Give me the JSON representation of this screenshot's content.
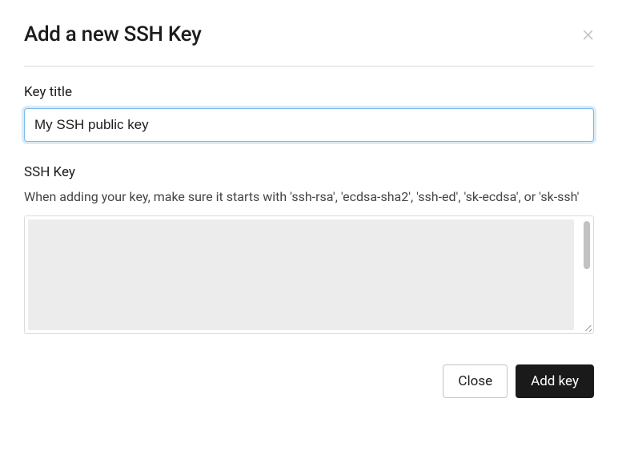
{
  "dialog": {
    "title": "Add a new SSH Key",
    "close_symbol": "×"
  },
  "form": {
    "key_title": {
      "label": "Key title",
      "value": "My SSH public key"
    },
    "ssh_key": {
      "label": "SSH Key",
      "helper": "When adding your key, make sure it starts with 'ssh-rsa', 'ecdsa-sha2', 'ssh-ed', 'sk-ecdsa', or 'sk-ssh'",
      "value": ""
    }
  },
  "footer": {
    "close_label": "Close",
    "add_label": "Add key"
  }
}
